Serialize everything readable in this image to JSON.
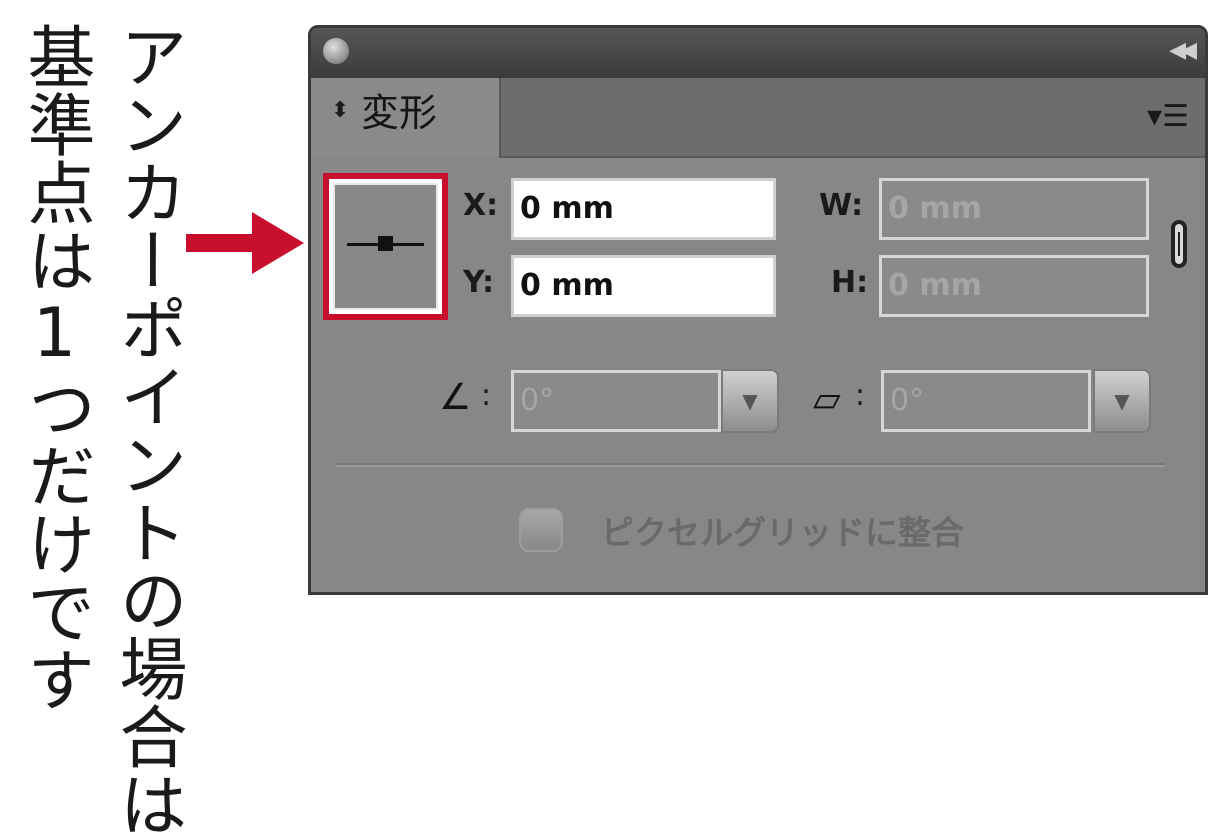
{
  "annotation": {
    "column1": "アンカーポイントの場合は",
    "column2": "基準点は1つだけです"
  },
  "colors": {
    "highlight": "#c8102e",
    "panel_bg": "#878787"
  },
  "panel": {
    "tab_title": "変形",
    "tab_toggle_icon": "updown-arrows-icon",
    "menu_icon": "panel-menu-icon",
    "x_label": "X:",
    "x_value": "0 mm",
    "y_label": "Y:",
    "y_value": "0 mm",
    "w_label": "W:",
    "w_value": "0 mm",
    "h_label": "H:",
    "h_value": "0 mm",
    "rotate_label": ":",
    "rotate_value": "0°",
    "shear_label": ":",
    "shear_value": "0°",
    "pixel_grid_label": "ピクセルグリッドに整合"
  }
}
